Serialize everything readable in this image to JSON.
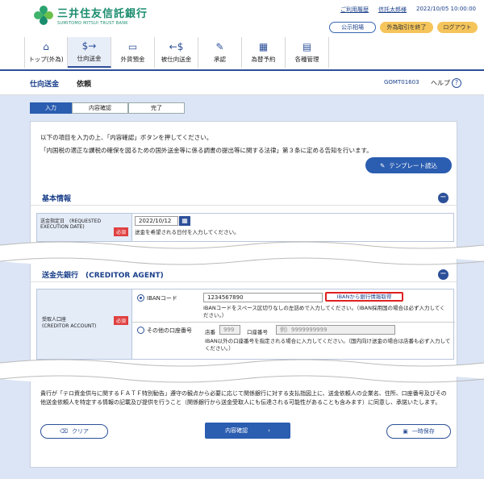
{
  "logo": {
    "jp": "三井住友信託銀行",
    "en": "SUMITOMO MITSUI TRUST BANK"
  },
  "toplinks": {
    "usage": "ご利用履歴",
    "user": "信託太郎様",
    "datetime": "2022/10/05 10:00:00"
  },
  "topbuttons": {
    "notice": "公示相場",
    "fx_end": "外為取引を終了",
    "logout": "ログアウト"
  },
  "gnav": [
    {
      "label": "トップ(外為)",
      "icon": "home-icon"
    },
    {
      "label": "仕向送金",
      "icon": "remit-icon"
    },
    {
      "label": "外貨預金",
      "icon": "deposit-icon"
    },
    {
      "label": "被仕向送金",
      "icon": "incoming-icon"
    },
    {
      "label": "承認",
      "icon": "approve-icon"
    },
    {
      "label": "為替予約",
      "icon": "contract-icon"
    },
    {
      "label": "各種管理",
      "icon": "manage-icon"
    }
  ],
  "title": {
    "section": "仕向送金",
    "page": "依頼",
    "code": "GOMT01603",
    "help": "ヘルプ",
    "help_icon": "?"
  },
  "steps": [
    "入力",
    "内容確認",
    "完了"
  ],
  "intro": {
    "line1": "以下の項目を入力の上、「内容確認」ボタンを押してください。",
    "line2": "「内国税の適正な課税の確保を図るための国外送金等に係る調書の提出等に関する法律」第３条に定める告知を行います。"
  },
  "template_button": "テンプレート読込",
  "basic": {
    "title": "基本情報",
    "date_label": "送金指定日　(REQUESTED EXECUTION DATE)",
    "required": "必須",
    "date_value": "2022/10/12",
    "date_note": "送金を希望される日付を入力してください。"
  },
  "creditor": {
    "title": "送金先銀行　(CREDITOR AGENT)",
    "account_label": "受取人口座",
    "account_label_en": "(CREDITOR ACCOUNT)",
    "required": "必須",
    "iban_label": "IBANコード",
    "iban_value": "1234567890",
    "iban_link": "IBANから銀行情報取得",
    "iban_note": "IBANコードをスペース区切りなしの左詰めで入力してください。（IBAN採用国の場合は必ず入力してください。）",
    "other_label": "その他の口座番号",
    "branch_label": "店番",
    "branch_placeholder": "999",
    "acct_label": "口座番号",
    "acct_placeholder": "例）9999999999",
    "other_note": "IBAN以外の口座番号を指定される場合に入力してください。（国内向け送金の場合は店番も必ず入力してください。）"
  },
  "footer_note": "貴行が「テロ資金供与に関するＦＡＴＦ特別勧告」遵守の観点から必要に応じて関係銀行に対する支払指図上に、送金依頼人の企業名、住所、口座番号及びその他送金依頼人を特定する情報の記載及び提供を行うこと（関係銀行から送金受取人にも伝達される可能性があることも含みます）に同意し、承諾いたします。",
  "buttons": {
    "clear": "クリア",
    "confirm": "内容確認",
    "save": "一時保存"
  },
  "colors": {
    "accent": "#2b5db0",
    "brand": "#1a8c6e",
    "required": "#e04040",
    "bg": "#dbe5f5"
  }
}
